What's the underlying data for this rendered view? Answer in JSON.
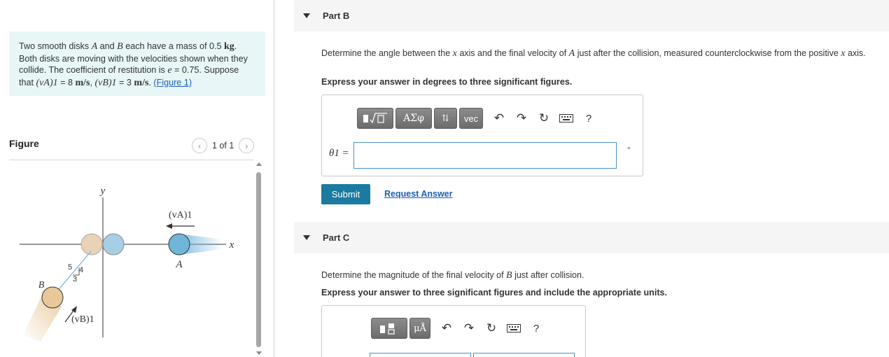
{
  "problem": {
    "text_1": "Two smooth disks ",
    "var_A": "A",
    "text_2": " and ",
    "var_B": "B",
    "text_3": " each have a mass of 0.5 ",
    "unit_kg": "kg",
    "text_4": ". Both disks are moving with the velocities shown when they collide. The coefficient of restitution is ",
    "var_e": "e",
    "text_5": " = 0.75. Suppose that ",
    "var_vA1": "(vA)1",
    "text_6": " = 8 ",
    "unit_ms1": "m/s",
    "text_7": ", ",
    "var_vB1": "(vB)1",
    "text_8": " = 3 ",
    "unit_ms2": "m/s",
    "text_9": ". ",
    "figure_link": "(Figure 1)",
    "text_10": ""
  },
  "figure": {
    "label": "Figure",
    "pager": "1 of 1",
    "prev_icon": "chevron-left-icon",
    "next_icon": "chevron-right-icon",
    "diagram": {
      "y_axis": "y",
      "x_axis": "x",
      "disk_A_label": "A",
      "disk_B_label": "B",
      "velocity_A_label": "(vA)1",
      "velocity_B_label": "(vB)1",
      "triangle_hyp": "5",
      "triangle_vert": "4",
      "triangle_horiz": "3",
      "disk_A_color": "#6fb6d9",
      "disk_B_color": "#e8c79a"
    }
  },
  "part_b": {
    "title": "Part B",
    "question_1": "Determine the angle between the ",
    "q_var_x1": "x",
    "question_2": " axis and the final velocity of ",
    "q_var_A": "A",
    "question_3": " just after the collision, measured counterclockwise from the positive ",
    "q_var_x2": "x",
    "question_4": " axis.",
    "instruction": "Express your answer in degrees to three significant figures.",
    "toolbar": {
      "templates_icon": "templates-icon",
      "greek_label": "ΑΣφ",
      "arrows_icon": "up-down-arrows-icon",
      "vec_label": "vec",
      "undo_icon": "undo-icon",
      "redo_icon": "redo-icon",
      "reset_icon": "reset-icon",
      "keyboard_icon": "keyboard-icon",
      "help_label": "?"
    },
    "input_label": "θ1 =",
    "input_value": "",
    "unit": "°",
    "submit_label": "Submit",
    "request_label": "Request Answer"
  },
  "part_c": {
    "title": "Part C",
    "question_1": "Determine the magnitude of the final velocity of ",
    "q_var_B": "B",
    "question_2": " just after collision.",
    "instruction": "Express your answer to three significant figures and include the appropriate units.",
    "toolbar": {
      "templates_icon": "templates-icon",
      "units_label": "μÅ",
      "undo_icon": "undo-icon",
      "redo_icon": "redo-icon",
      "reset_icon": "reset-icon",
      "keyboard_icon": "keyboard-icon",
      "help_label": "?"
    }
  },
  "colors": {
    "problem_bg": "#e8f6f7",
    "submit_bg": "#1b7aa0",
    "link": "#1a5fb4",
    "input_border": "#4a90c8"
  }
}
